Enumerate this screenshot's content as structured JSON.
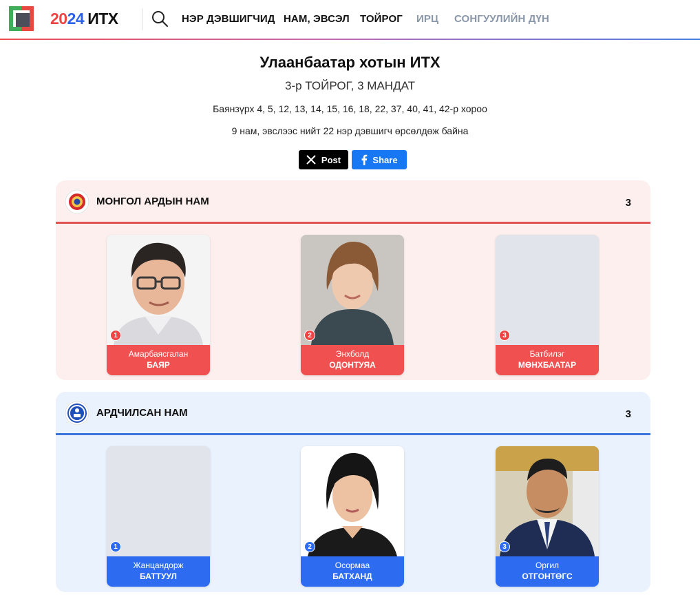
{
  "header": {
    "logo_year_a": "20",
    "logo_year_b": "24",
    "logo_word": "ИТХ",
    "nav": [
      {
        "label": "НЭР ДЭВШИГЧИД",
        "muted": false
      },
      {
        "label": "НАМ, ЭВСЭЛ",
        "muted": false
      },
      {
        "label": "ТОЙРОГ",
        "muted": false
      },
      {
        "label": "ИРЦ",
        "muted": true
      },
      {
        "label": "СОНГУУЛИЙН ДҮН",
        "muted": true
      }
    ]
  },
  "page": {
    "title": "Улаанбаатар хотын ИТХ",
    "subtitle": "3-р ТОЙРОГ, 3 МАНДАТ",
    "wards": "Баянзүрх 4, 5, 12, 13, 14, 15, 16, 18, 22, 37, 40, 41, 42-р хороо",
    "summary": "9 нам, эвслээс нийт 22 нэр дэвшигч өрсөлдөж байна"
  },
  "share": {
    "x_label": "Post",
    "fb_label": "Share"
  },
  "parties": [
    {
      "name": "МОНГОЛ АРДЫН НАМ",
      "count": "3",
      "color": "#f05050",
      "candidates": [
        {
          "num": "1",
          "first": "Амарбаясгалан",
          "last": "БАЯР",
          "photo": "man-glasses"
        },
        {
          "num": "2",
          "first": "Энхболд",
          "last": "ОДОНТУЯА",
          "photo": "woman-short-hair"
        },
        {
          "num": "3",
          "first": "Батбилэг",
          "last": "МӨНХБААТАР",
          "photo": "none"
        }
      ]
    },
    {
      "name": "АРДЧИЛСАН НАМ",
      "count": "3",
      "color": "#2d6bf0",
      "candidates": [
        {
          "num": "1",
          "first": "Жанцандорж",
          "last": "БАТТУУЛ",
          "photo": "none"
        },
        {
          "num": "2",
          "first": "Осормаа",
          "last": "БАТХАНД",
          "photo": "woman-long-hair"
        },
        {
          "num": "3",
          "first": "Оргил",
          "last": "ОТГОНТӨГС",
          "photo": "man-suit"
        }
      ]
    }
  ]
}
